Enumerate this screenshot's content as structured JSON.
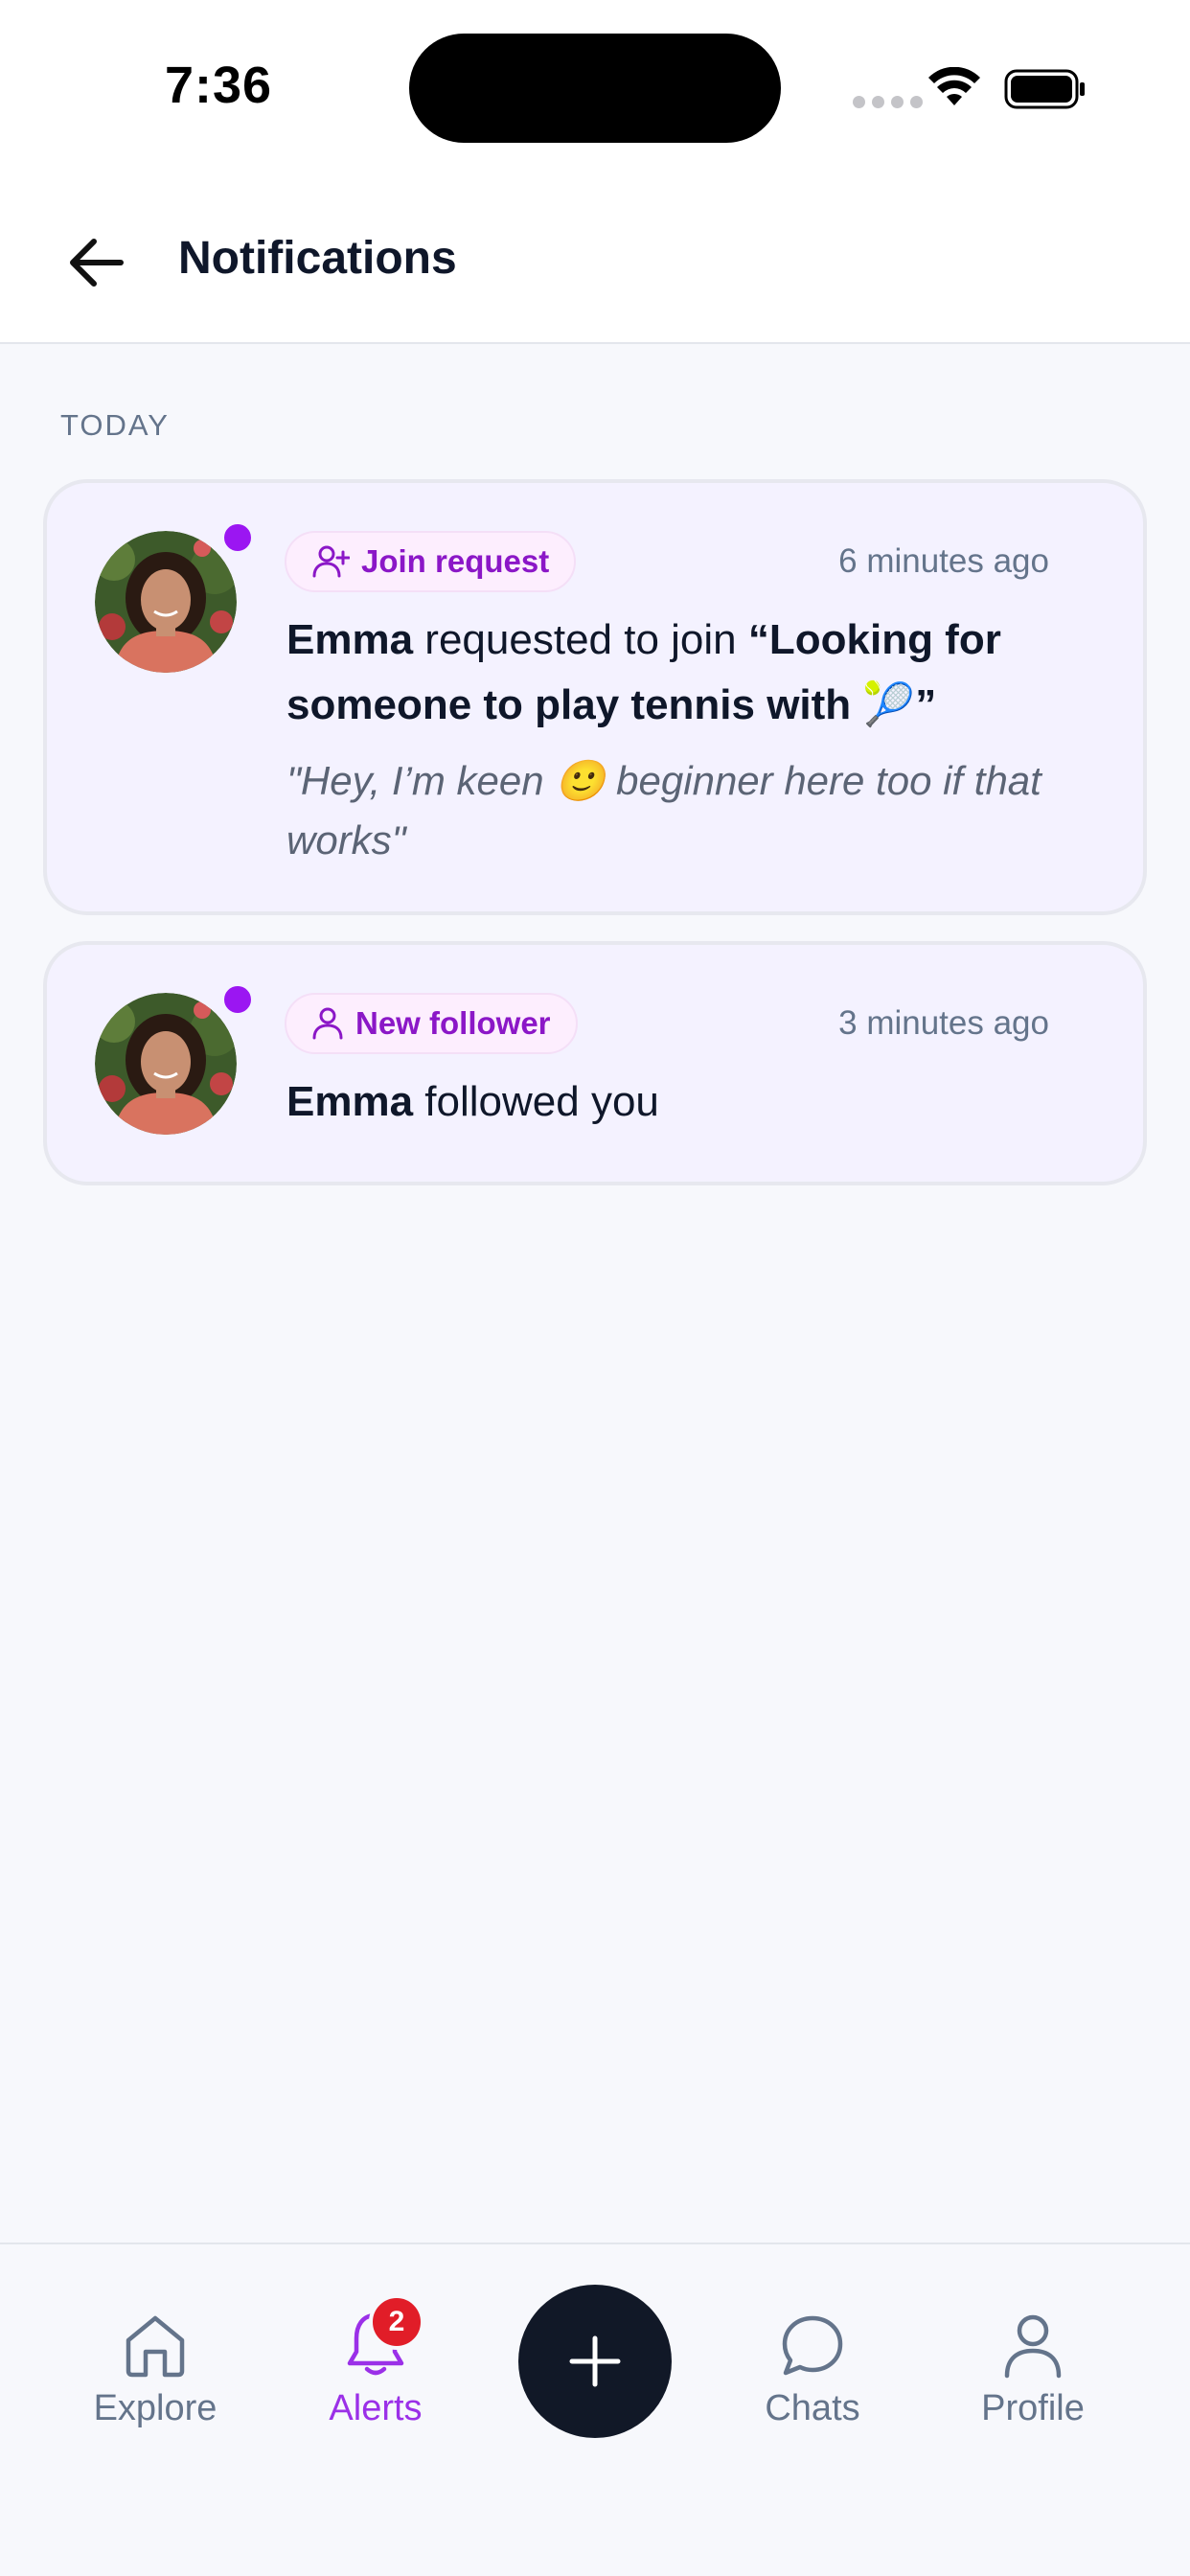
{
  "status_bar": {
    "time": "7:36"
  },
  "header": {
    "title": "Notifications"
  },
  "section": {
    "label": "TODAY"
  },
  "notifications": [
    {
      "type_label": "Join request",
      "type_icon": "user-plus-icon",
      "time_ago": "6 minutes ago",
      "actor": "Emma",
      "action": " requested to join ",
      "target": "“Looking for someone to play tennis with 🎾”",
      "message": "\"Hey, I’m keen 🙂 beginner here too if that works\"",
      "unread": true
    },
    {
      "type_label": "New follower",
      "type_icon": "user-icon",
      "time_ago": "3 minutes ago",
      "actor": "Emma",
      "action": " followed you",
      "unread": true
    }
  ],
  "bottom_nav": {
    "items": [
      {
        "label": "Explore",
        "icon": "home-icon",
        "active": false
      },
      {
        "label": "Alerts",
        "icon": "bell-icon",
        "active": true,
        "badge": "2"
      },
      {
        "label": "Chats",
        "icon": "chat-bubble-icon",
        "active": false
      },
      {
        "label": "Profile",
        "icon": "user-icon",
        "active": false
      }
    ],
    "fab_icon": "plus-icon"
  },
  "colors": {
    "accent": "#9b16f2",
    "badge": "#e11d28",
    "card_bg": "#f4f2ff",
    "fab_bg": "#111827"
  }
}
